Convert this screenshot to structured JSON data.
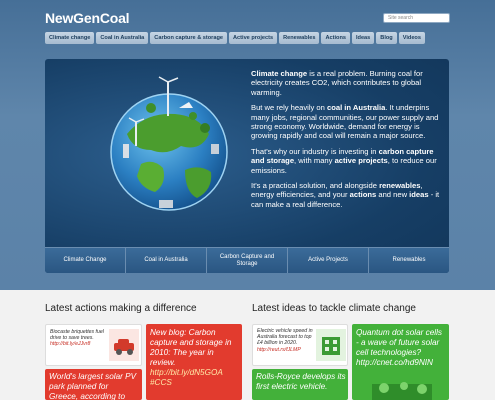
{
  "header": {
    "logo": "NewGenCoal",
    "search_placeholder": "Site search"
  },
  "nav": {
    "tabs": [
      "Climate change",
      "Coal in Australia",
      "Carbon capture & storage",
      "Active projects",
      "Renewables",
      "Actions",
      "Ideas",
      "Blog",
      "Videos"
    ]
  },
  "hero": {
    "p1_bold": "Climate change",
    "p1": " is a real problem. Burning coal for electricity creates CO2, which contributes to global warming.",
    "p2_a": "But we rely heavily on ",
    "p2_bold": "coal in Australia",
    "p2_b": ". It underpins many jobs, regional communities, our power supply and strong economy. Worldwide, demand for energy is growing rapidly and coal will remain a major source.",
    "p3_a": "That's why our industry is investing in ",
    "p3_bold1": "carbon capture and storage",
    "p3_b": ", with many ",
    "p3_bold2": "active projects",
    "p3_c": ", to reduce our emissions.",
    "p4_a": "It's a practical solution, and alongside ",
    "p4_bold1": "renewables",
    "p4_b": ", energy efficiencies, and your ",
    "p4_bold2": "actions",
    "p4_c": " and new ",
    "p4_bold3": "ideas",
    "p4_d": " - it can make a real difference.",
    "tabs": [
      "Climate Change",
      "Coal in Australia",
      "Carbon Capture and Storage",
      "Active Projects",
      "Renewables"
    ]
  },
  "actions": {
    "title": "Latest actions making a difference",
    "card1": "Biocaste briquettes fuel drive to save trees.",
    "card1_link": "http://bit.ly/eJJvr8",
    "card2": "New blog: Carbon capture and storage in 2010: The year in review.",
    "card2_link": "http://bit.ly/dN5GOA",
    "card2_tag": "#CCS",
    "card3": "World's largest solar PV park planned for Greece, according to"
  },
  "ideas": {
    "title": "Latest ideas to tackle climate change",
    "card1": "Electric vehicle speed in Australia forecast to top £4 billion in 2020.",
    "card1_link": "http://reut.rs/fJLMP",
    "card2": "Rolls-Royce develops its first electric vehicle.",
    "card3": "Quantum dot solar cells - a wave of future solar cell technologies?",
    "card3_link": "http://cnet.co/hd9NIN"
  },
  "colors": {
    "header_blue": "#5b82a8",
    "hero_navy": "#163e65",
    "card_red": "#e23b2e",
    "card_green": "#43b13a"
  }
}
